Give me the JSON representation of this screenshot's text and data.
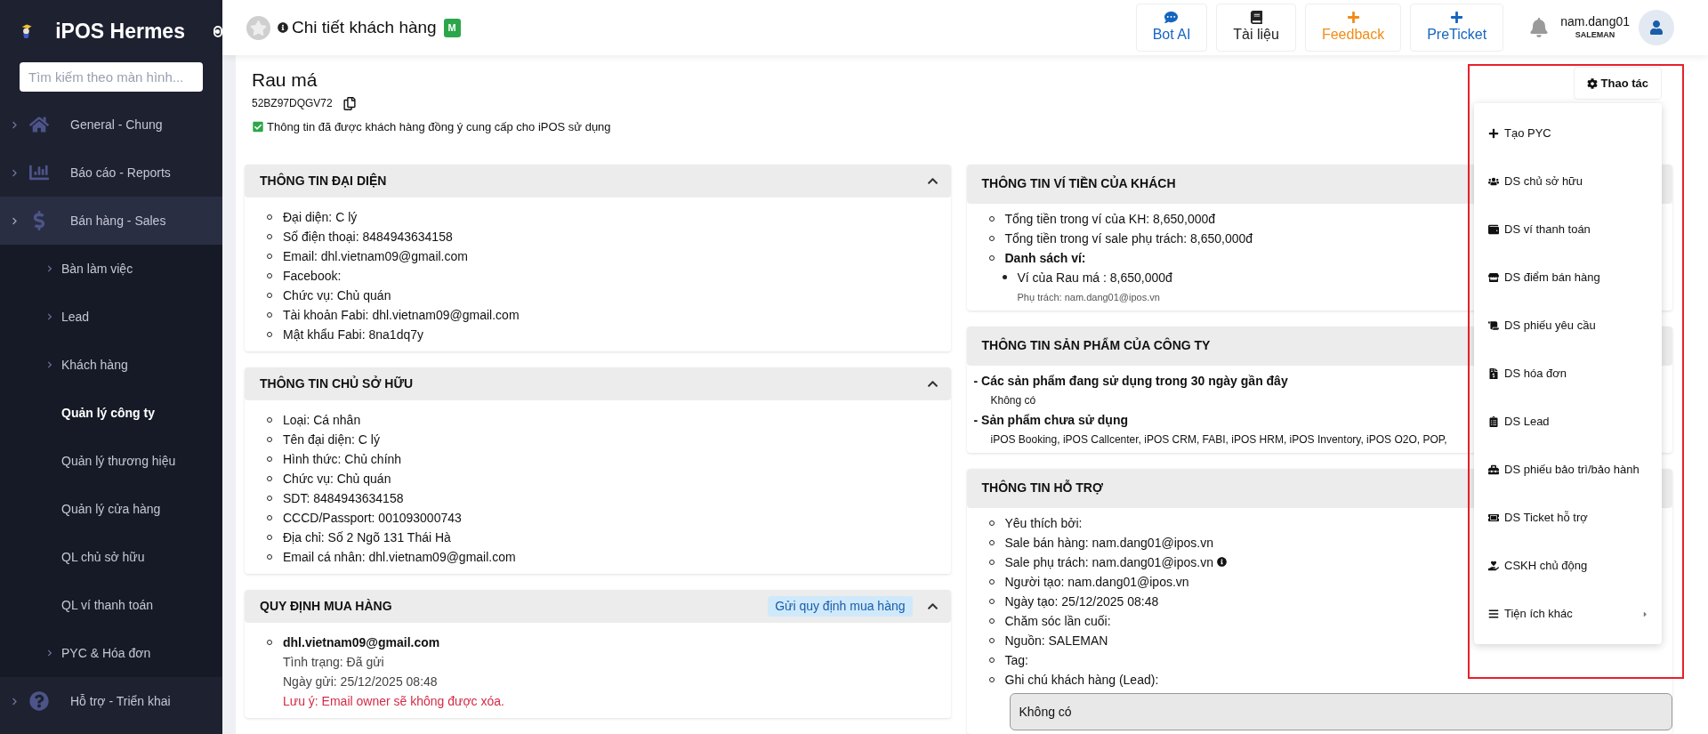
{
  "sidebar": {
    "brand": "iPOS Hermes",
    "search": {
      "placeholder": "Tìm kiếm theo màn hình..."
    },
    "items": [
      {
        "label": "General - Chung",
        "expanded": false
      },
      {
        "label": "Báo cáo - Reports",
        "expanded": false
      },
      {
        "label": "Bán hàng - Sales",
        "expanded": true,
        "children": [
          {
            "label": "Bàn làm việc",
            "expandable": true,
            "selected": false
          },
          {
            "label": "Lead",
            "expandable": true,
            "selected": false
          },
          {
            "label": "Khách hàng",
            "expandable": true,
            "selected": false
          },
          {
            "label": "Quản lý công ty",
            "expandable": false,
            "selected": true
          },
          {
            "label": "Quản lý thương hiệu",
            "expandable": false,
            "selected": false
          },
          {
            "label": "Quản lý cửa hàng",
            "expandable": false,
            "selected": false
          },
          {
            "label": "QL chủ sở hữu",
            "expandable": false,
            "selected": false
          },
          {
            "label": "QL ví thanh toán",
            "expandable": false,
            "selected": false
          },
          {
            "label": "PYC & Hóa đơn",
            "expandable": true,
            "selected": false
          }
        ]
      },
      {
        "label": "Hỗ trợ - Triển khai",
        "expanded": false
      }
    ]
  },
  "header": {
    "title": "Chi tiết khách hàng",
    "badge": "M",
    "actions": [
      {
        "label": "Bot AI",
        "kind": "chat",
        "color": "#1565c0"
      },
      {
        "label": "Tài liệu",
        "kind": "docs",
        "color": "#222222"
      },
      {
        "label": "Feedback",
        "kind": "add",
        "color": "#f28c18"
      },
      {
        "label": "PreTicket",
        "kind": "add",
        "color": "#1565c0"
      }
    ],
    "user": {
      "name": "nam.dang01",
      "role": "SALEMAN"
    }
  },
  "customer": {
    "name": "Rau má",
    "code": "52BZ97DQGV72",
    "consent": "Thông tin đã được khách hàng đồng ý cung cấp cho iPOS sử dụng"
  },
  "left_cards": [
    {
      "title": "THÔNG TIN ĐẠI DIỆN",
      "expanded": true,
      "lines": [
        {
          "kind": "bullet",
          "text": "Đại diện: C lý"
        },
        {
          "kind": "bullet",
          "text": "Số điện thoại: 8484943634158"
        },
        {
          "kind": "bullet",
          "text": "Email: dhl.vietnam09@gmail.com"
        },
        {
          "kind": "bullet",
          "text": "Facebook:"
        },
        {
          "kind": "bullet",
          "text": "Chức vụ: Chủ quán"
        },
        {
          "kind": "bullet",
          "text": "Tài khoản Fabi: dhl.vietnam09@gmail.com"
        },
        {
          "kind": "bullet",
          "text": "Mật khẩu Fabi: 8na1dq7y"
        }
      ]
    },
    {
      "title": "THÔNG TIN CHỦ SỞ HỮU",
      "expanded": true,
      "lines": [
        {
          "kind": "bullet",
          "text": "Loại: Cá nhân"
        },
        {
          "kind": "bullet",
          "text": "Tên đại diện: C lý"
        },
        {
          "kind": "bullet",
          "text": "Hình thức: Chủ chính"
        },
        {
          "kind": "bullet",
          "text": "Chức vụ: Chủ quán"
        },
        {
          "kind": "bullet",
          "text": "SDT: 8484943634158"
        },
        {
          "kind": "bullet",
          "text": "CCCD/Passport: 001093000743"
        },
        {
          "kind": "bullet",
          "text": "Địa chỉ: Số 2 Ngõ 131 Thái Hà"
        },
        {
          "kind": "bullet",
          "text": "Email cá nhân: dhl.vietnam09@gmail.com"
        }
      ]
    },
    {
      "title": "QUY ĐỊNH MUA HÀNG",
      "expanded": true,
      "action": "Gửi quy định mua hàng",
      "lines": [
        {
          "kind": "bullet-bold",
          "text": "dhl.vietnam09@gmail.com"
        },
        {
          "kind": "detail",
          "text": "Tình trạng: Đã gửi"
        },
        {
          "kind": "detail",
          "text": "Ngày gửi: 25/12/2025 08:48"
        },
        {
          "kind": "warning",
          "text": "Lưu ý: Email owner sẽ không được xóa."
        }
      ]
    }
  ],
  "right_cards": [
    {
      "title": "THÔNG TIN VÍ TIỀN CỦA KHÁCH",
      "expanded": true,
      "lines": [
        {
          "kind": "bullet",
          "text": "Tổng tiền trong ví của KH: 8,650,000đ"
        },
        {
          "kind": "bullet",
          "text": "Tổng tiền trong ví sale phụ trách: 8,650,000đ"
        },
        {
          "kind": "bullet-bold",
          "text": "Danh sách ví:"
        },
        {
          "kind": "sub-bullet",
          "text": "Ví của Rau má : 8,650,000đ"
        },
        {
          "kind": "caption",
          "text": "Phụ trách: nam.dang01@ipos.vn"
        }
      ]
    },
    {
      "title": "THÔNG TIN SẢN PHẨM CỦA CÔNG TY",
      "expanded": true,
      "lines": [
        {
          "kind": "heading",
          "text": "- Các sản phẩm đang sử dụng trong 30 ngày gần đây"
        },
        {
          "kind": "indented",
          "text": "Không có"
        },
        {
          "kind": "heading",
          "text": "- Sản phẩm chưa sử dụng"
        },
        {
          "kind": "indented",
          "text": "iPOS Booking, iPOS Callcenter, iPOS CRM, FABI, iPOS HRM, iPOS Inventory, iPOS O2O, POP,"
        }
      ]
    },
    {
      "title": "THÔNG TIN HỖ TRỢ",
      "expanded": true,
      "lines": [
        {
          "kind": "bullet",
          "text": "Yêu thích bởi:"
        },
        {
          "kind": "bullet",
          "text": "Sale bán hàng: nam.dang01@ipos.vn"
        },
        {
          "kind": "bullet-info",
          "text": "Sale phụ trách: nam.dang01@ipos.vn"
        },
        {
          "kind": "bullet",
          "text": "Người tạo: nam.dang01@ipos.vn"
        },
        {
          "kind": "bullet",
          "text": "Ngày tạo: 25/12/2025 08:48"
        },
        {
          "kind": "bullet",
          "text": "Chăm sóc lần cuối:"
        },
        {
          "kind": "bullet",
          "text": "Nguồn: SALEMAN"
        },
        {
          "kind": "bullet",
          "text": "Tag:"
        },
        {
          "kind": "bullet",
          "text": "Ghi chú khách hàng (Lead):"
        },
        {
          "kind": "note",
          "text": "Không có"
        }
      ]
    }
  ],
  "actions_menu": {
    "button": "Thao tác",
    "highlighted": true,
    "items": [
      {
        "label": "Tạo PYC",
        "has_submenu": false
      },
      {
        "label": "DS chủ sở hữu",
        "has_submenu": false
      },
      {
        "label": "DS ví thanh toán",
        "has_submenu": false
      },
      {
        "label": "DS điểm bán hàng",
        "has_submenu": false
      },
      {
        "label": "DS phiếu yêu cầu",
        "has_submenu": false
      },
      {
        "label": "DS hóa đơn",
        "has_submenu": false
      },
      {
        "label": "DS Lead",
        "has_submenu": false
      },
      {
        "label": "DS phiếu bảo trì/bảo hành",
        "has_submenu": false
      },
      {
        "label": "DS Ticket hỗ trợ",
        "has_submenu": false
      },
      {
        "label": "CSKH chủ động",
        "has_submenu": false
      },
      {
        "label": "Tiện ích khác",
        "has_submenu": true
      }
    ]
  }
}
